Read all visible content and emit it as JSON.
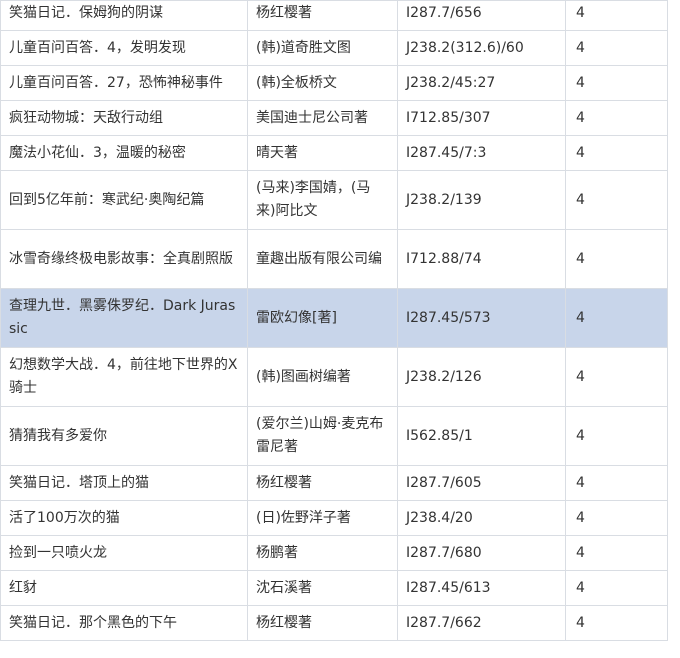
{
  "table": {
    "rows": [
      {
        "title": "笑猫日记．保姆狗的阴谋",
        "author": "杨红樱著",
        "call_no": "I287.7/656",
        "count": "4",
        "selected": false,
        "tall": false
      },
      {
        "title": "儿童百问百答．4，发明发现",
        "author": "(韩)道奇胜文图",
        "call_no": "J238.2(312.6)/60",
        "count": "4",
        "selected": false,
        "tall": false
      },
      {
        "title": "儿童百问百答．27，恐怖神秘事件",
        "author": "(韩)全板桥文",
        "call_no": "J238.2/45:27",
        "count": "4",
        "selected": false,
        "tall": false
      },
      {
        "title": "疯狂动物城：天敌行动组",
        "author": "美国迪士尼公司著",
        "call_no": "I712.85/307",
        "count": "4",
        "selected": false,
        "tall": false
      },
      {
        "title": "魔法小花仙．3，温暖的秘密",
        "author": "晴天著",
        "call_no": "I287.45/7:3",
        "count": "4",
        "selected": false,
        "tall": false
      },
      {
        "title": "回到5亿年前：寒武纪·奥陶纪篇",
        "author": "(马来)李国婧，(马来)阿比文",
        "call_no": "J238.2/139",
        "count": "4",
        "selected": false,
        "tall": true
      },
      {
        "title": "冰雪奇缘终极电影故事：全真剧照版",
        "author": "童趣出版有限公司编",
        "call_no": "I712.88/74",
        "count": "4",
        "selected": false,
        "tall": true
      },
      {
        "title": "查理九世．黑雾侏罗纪．Dark Jurassic",
        "author": "雷欧幻像[著]",
        "call_no": "I287.45/573",
        "count": "4",
        "selected": true,
        "tall": true
      },
      {
        "title": "幻想数学大战．4，前往地下世界的X骑士",
        "author": "(韩)图画树编著",
        "call_no": "J238.2/126",
        "count": "4",
        "selected": false,
        "tall": true
      },
      {
        "title": "猜猜我有多爱你",
        "author": "(爱尔兰)山姆·麦克布雷尼著",
        "call_no": "I562.85/1",
        "count": "4",
        "selected": false,
        "tall": true
      },
      {
        "title": "笑猫日记．塔顶上的猫",
        "author": "杨红樱著",
        "call_no": "I287.7/605",
        "count": "4",
        "selected": false,
        "tall": false
      },
      {
        "title": "活了100万次的猫",
        "author": "(日)佐野洋子著",
        "call_no": "J238.4/20",
        "count": "4",
        "selected": false,
        "tall": false
      },
      {
        "title": "捡到一只喷火龙",
        "author": "杨鹏著",
        "call_no": "I287.7/680",
        "count": "4",
        "selected": false,
        "tall": false
      },
      {
        "title": "红豺",
        "author": "沈石溪著",
        "call_no": "I287.45/613",
        "count": "4",
        "selected": false,
        "tall": false
      },
      {
        "title": "笑猫日记．那个黑色的下午",
        "author": "杨红樱著",
        "call_no": "I287.7/662",
        "count": "4",
        "selected": false,
        "tall": false
      }
    ]
  }
}
